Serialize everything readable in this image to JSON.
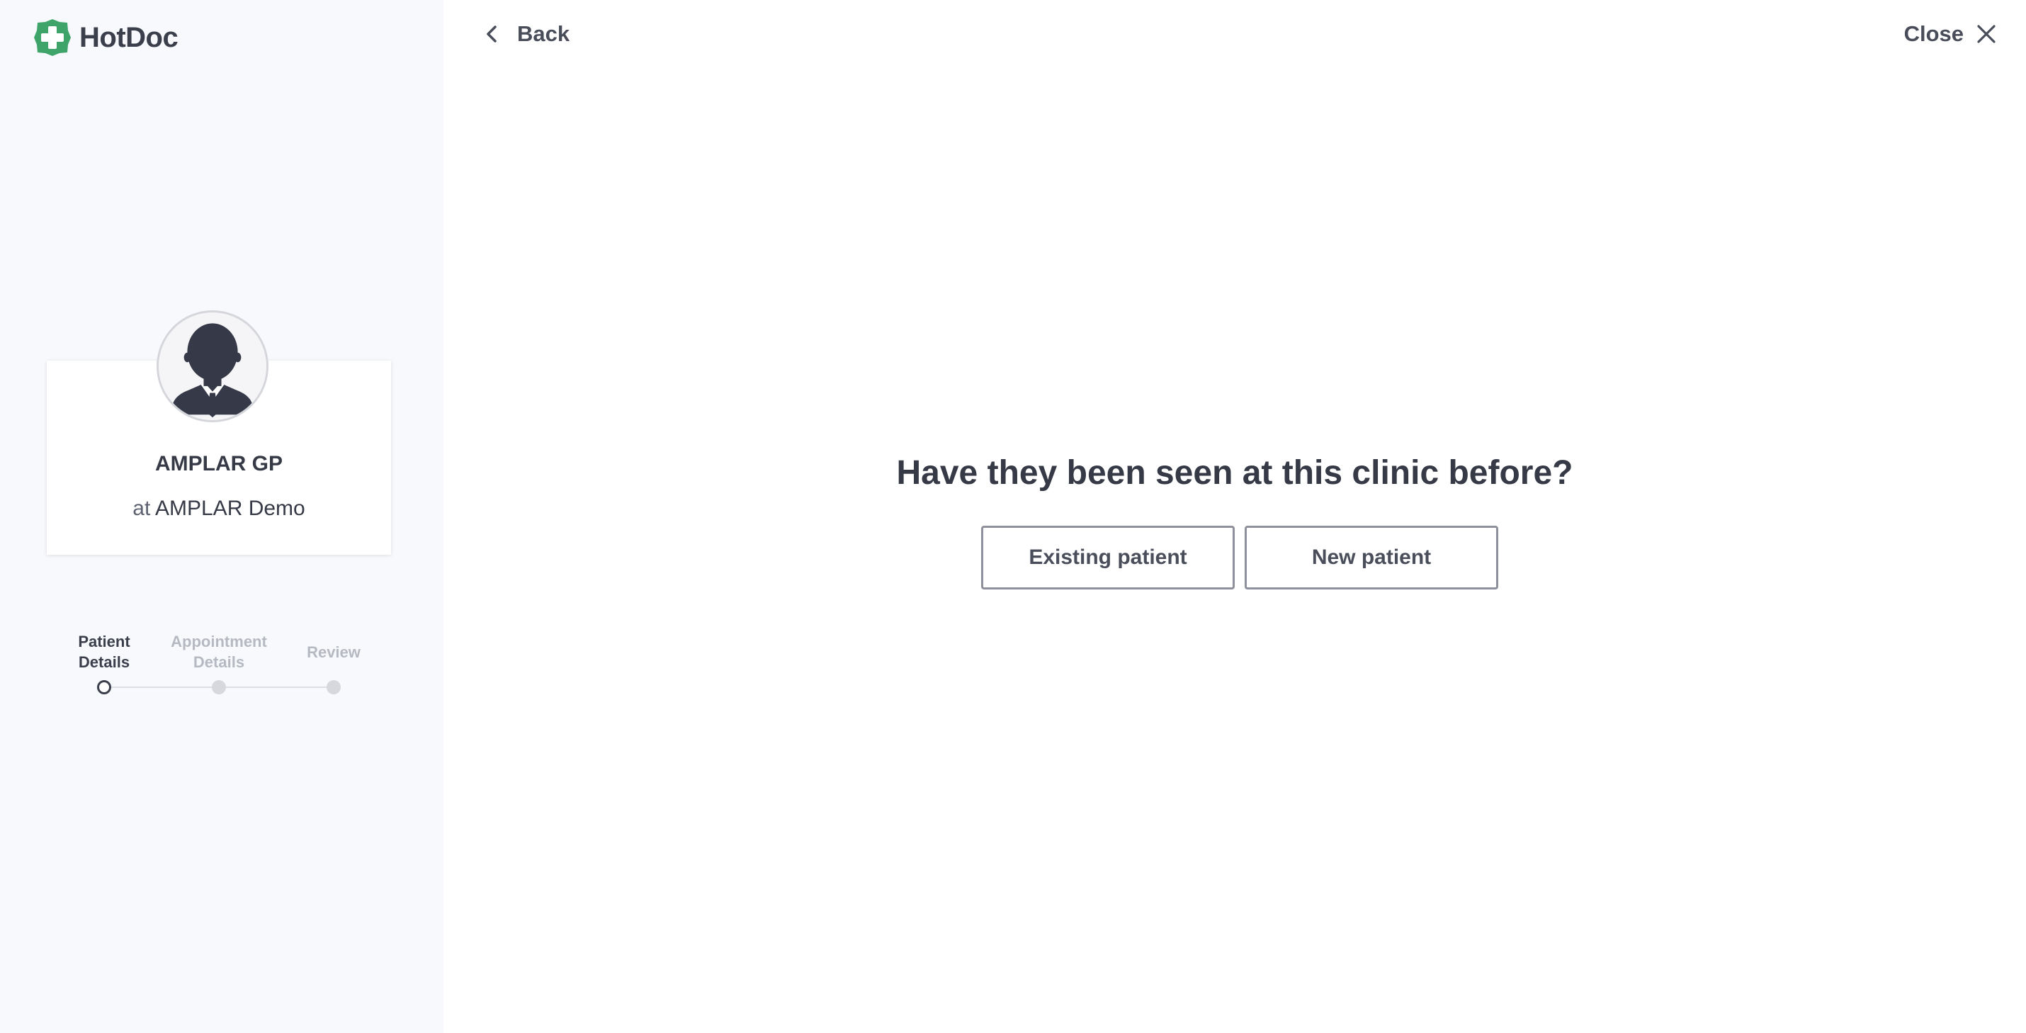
{
  "brand": {
    "name": "HotDoc",
    "logo_icon": "green-cross-badge-icon",
    "accent_color": "#3fa46a"
  },
  "header": {
    "back_label": "Back",
    "close_label": "Close"
  },
  "doctor": {
    "name": "AMPLAR GP",
    "clinic_prefix": "at",
    "clinic_name": "AMPLAR Demo",
    "avatar_icon": "person-silhouette-icon"
  },
  "steps": [
    {
      "label_line1": "Patient",
      "label_line2": "Details",
      "state": "active"
    },
    {
      "label_line1": "Appointment",
      "label_line2": "Details",
      "state": "upcoming"
    },
    {
      "label_line1": "Review",
      "label_line2": "",
      "state": "upcoming"
    }
  ],
  "main": {
    "question": "Have they been seen at this clinic before?",
    "options": [
      {
        "label": "Existing patient"
      },
      {
        "label": "New patient"
      }
    ]
  }
}
